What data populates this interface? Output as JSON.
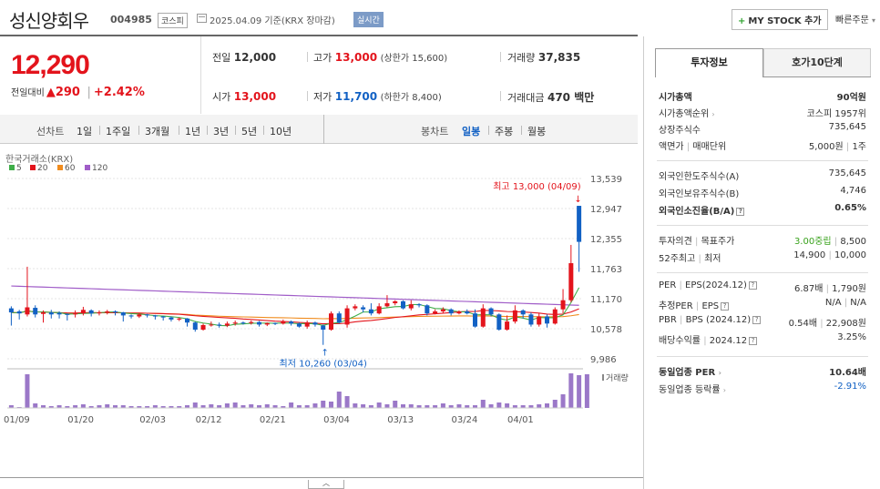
{
  "header": {
    "name": "성신양회우",
    "code": "004985",
    "market": "코스피",
    "date_text": "2025.04.09 기준(KRX 장마감)",
    "realtime": "실시간",
    "mystock_label": "MY STOCK 추가",
    "quick_order": "빠른주문"
  },
  "quote": {
    "price": "12,290",
    "change_label": "전일대비",
    "change_arrow": "▲",
    "change": "290",
    "change_pct": "+2.42%",
    "prev_label": "전일",
    "prev": "12,000",
    "high_label": "고가",
    "high": "13,000",
    "high_limit": "(상한가 15,600)",
    "volume_label": "거래량",
    "volume": "37,835",
    "open_label": "시가",
    "open": "13,000",
    "low_label": "저가",
    "low": "11,700",
    "low_limit": "(하한가 8,400)",
    "amount_label": "거래대금",
    "amount": "470 백만"
  },
  "toolbar": {
    "line_label": "선차트",
    "periods": [
      "1일",
      "1주일",
      "3개월",
      "1년",
      "3년",
      "5년",
      "10년"
    ],
    "candle_label": "봉차트",
    "candle_periods": [
      "일봉",
      "주봉",
      "월봉"
    ],
    "selected_candle": "일봉"
  },
  "chart_data": {
    "type": "candlestick",
    "source_label": "한국거래소(KRX)",
    "ma_legend": [
      {
        "name": "5",
        "color": "#3fae49"
      },
      {
        "name": "20",
        "color": "#e3141c"
      },
      {
        "name": "60",
        "color": "#f08c1e"
      },
      {
        "name": "120",
        "color": "#a05dc8"
      }
    ],
    "y_ticks": [
      "13,539",
      "12,947",
      "12,355",
      "11,763",
      "11,170",
      "10,578",
      "9,986"
    ],
    "ylim": [
      9986,
      13539
    ],
    "x_ticks": [
      "01/09",
      "01/20",
      "02/03",
      "02/12",
      "02/21",
      "03/04",
      "03/13",
      "03/24",
      "04/01"
    ],
    "annotation_high": "최고 13,000 (04/09)",
    "annotation_low": "최저 10,260 (03/04)",
    "volume_label": "거래량",
    "up_color": "#e3141c",
    "down_color": "#1261c4",
    "candles": [
      [
        10980,
        10900,
        11020,
        10640
      ],
      [
        10920,
        10880,
        10950,
        10760
      ],
      [
        10860,
        11000,
        11800,
        10820
      ],
      [
        10990,
        10860,
        11040,
        10800
      ],
      [
        10870,
        10900,
        10940,
        10700
      ],
      [
        10900,
        10860,
        10950,
        10780
      ],
      [
        10890,
        10860,
        10920,
        10780
      ],
      [
        10870,
        10850,
        10880,
        10740
      ],
      [
        10860,
        10880,
        10940,
        10800
      ],
      [
        10880,
        10950,
        11010,
        10840
      ],
      [
        10940,
        10880,
        10960,
        10820
      ],
      [
        10880,
        10900,
        10940,
        10840
      ],
      [
        10900,
        10920,
        10950,
        10860
      ],
      [
        10920,
        10900,
        10940,
        10840
      ],
      [
        10900,
        10840,
        10910,
        10720
      ],
      [
        10840,
        10820,
        10860,
        10780
      ],
      [
        10820,
        10860,
        10890,
        10790
      ],
      [
        10860,
        10840,
        10870,
        10800
      ],
      [
        10840,
        10820,
        10850,
        10760
      ],
      [
        10820,
        10800,
        10830,
        10740
      ],
      [
        10800,
        10760,
        10820,
        10720
      ],
      [
        10760,
        10780,
        10800,
        10730
      ],
      [
        10780,
        10700,
        10790,
        10620
      ],
      [
        10700,
        10560,
        10720,
        10520
      ],
      [
        10560,
        10650,
        10680,
        10540
      ],
      [
        10650,
        10660,
        10720,
        10620
      ],
      [
        10660,
        10640,
        10700,
        10600
      ],
      [
        10640,
        10680,
        10720,
        10610
      ],
      [
        10680,
        10700,
        10740,
        10640
      ],
      [
        10700,
        10690,
        10720,
        10660
      ],
      [
        10690,
        10710,
        10740,
        10660
      ],
      [
        10710,
        10660,
        10730,
        10620
      ],
      [
        10660,
        10690,
        10700,
        10630
      ],
      [
        10690,
        10680,
        10700,
        10650
      ],
      [
        10680,
        10720,
        10760,
        10660
      ],
      [
        10720,
        10680,
        10740,
        10640
      ],
      [
        10680,
        10620,
        10700,
        10600
      ],
      [
        10620,
        10700,
        10740,
        10580
      ],
      [
        10700,
        10660,
        10720,
        10620
      ],
      [
        10640,
        10560,
        10660,
        10260
      ],
      [
        10560,
        10880,
        10920,
        10540
      ],
      [
        10880,
        10700,
        10920,
        10680
      ],
      [
        10660,
        10980,
        11040,
        10600
      ],
      [
        10980,
        11020,
        11060,
        10940
      ],
      [
        11000,
        10960,
        11040,
        10900
      ],
      [
        10960,
        10880,
        11080,
        10840
      ],
      [
        10880,
        11020,
        11080,
        10860
      ],
      [
        11020,
        11080,
        11240,
        11000
      ],
      [
        11080,
        11120,
        11140,
        11040
      ],
      [
        11120,
        10980,
        11140,
        10960
      ],
      [
        10980,
        11060,
        11140,
        10940
      ],
      [
        11060,
        11040,
        11080,
        11000
      ],
      [
        11040,
        10880,
        11060,
        10840
      ],
      [
        10880,
        10920,
        10960,
        10860
      ],
      [
        10920,
        10960,
        11000,
        10880
      ],
      [
        10960,
        10880,
        10980,
        10840
      ],
      [
        10880,
        10920,
        10940,
        10860
      ],
      [
        10920,
        10880,
        10960,
        10860
      ],
      [
        10880,
        10620,
        10960,
        10600
      ],
      [
        10620,
        10980,
        11060,
        10600
      ],
      [
        10980,
        10860,
        11000,
        10820
      ],
      [
        10860,
        10560,
        10880,
        10540
      ],
      [
        10560,
        10720,
        10840,
        10540
      ],
      [
        10720,
        10940,
        11040,
        10680
      ],
      [
        10940,
        10860,
        10960,
        10780
      ],
      [
        10860,
        10660,
        10900,
        10620
      ],
      [
        10660,
        10820,
        10880,
        10620
      ],
      [
        10820,
        10680,
        10860,
        10600
      ],
      [
        10680,
        10960,
        11000,
        10660
      ],
      [
        10960,
        11140,
        11360,
        10880
      ],
      [
        11140,
        11870,
        12230,
        11100
      ],
      [
        13000,
        12290,
        13000,
        11700
      ]
    ],
    "volumes": [
      3,
      1,
      37,
      5,
      3,
      2,
      3,
      2,
      3,
      4,
      2,
      3,
      4,
      3,
      3,
      2,
      2,
      2,
      3,
      2,
      2,
      2,
      3,
      6,
      3,
      4,
      3,
      5,
      6,
      3,
      4,
      3,
      4,
      3,
      2,
      6,
      3,
      3,
      5,
      8,
      7,
      18,
      13,
      5,
      4,
      3,
      6,
      4,
      8,
      4,
      4,
      3,
      3,
      3,
      5,
      3,
      4,
      3,
      3,
      9,
      4,
      6,
      5,
      3,
      3,
      3,
      4,
      5,
      9,
      15,
      38,
      36,
      37
    ]
  },
  "right_panel": {
    "tabs": [
      "투자정보",
      "호가10단계"
    ],
    "market_cap_label": "시가총액",
    "market_cap": "90억원",
    "market_cap_rank_label": "시가총액순위",
    "market_cap_rank": "코스피 1957위",
    "shares_label": "상장주식수",
    "shares": "735,645",
    "par_label": "액면가",
    "unit_label": "매매단위",
    "par": "5,000원",
    "unit": "1주",
    "foreign_limit_label": "외국인한도주식수(A)",
    "foreign_limit": "735,645",
    "foreign_hold_label": "외국인보유주식수(B)",
    "foreign_hold": "4,746",
    "foreign_ratio_label": "외국인소진율(B/A)",
    "foreign_ratio": "0.65%",
    "opinion_label": "투자의견",
    "target_label": "목표주가",
    "opinion": "3.00중립",
    "target": "8,500",
    "w52_label": "52주최고",
    "w52_low_label": "최저",
    "w52_high": "14,900",
    "w52_low": "10,000",
    "per_label": "PER",
    "eps_label": "EPS(2024.12)",
    "per": "6.87배",
    "eps": "1,790원",
    "est_per_label": "추정PER",
    "est_eps_label": "EPS",
    "est_per": "N/A",
    "est_eps": "N/A",
    "pbr_label": "PBR",
    "bps_label": "BPS (2024.12)",
    "pbr": "0.54배",
    "bps": "22,908원",
    "div_label": "배당수익률",
    "div_period": "2024.12",
    "div": "3.25%",
    "industry_per_label": "동일업종 PER",
    "industry_per": "10.64배",
    "industry_rate_label": "동일업종 등락률",
    "industry_rate": "-2.91%"
  }
}
